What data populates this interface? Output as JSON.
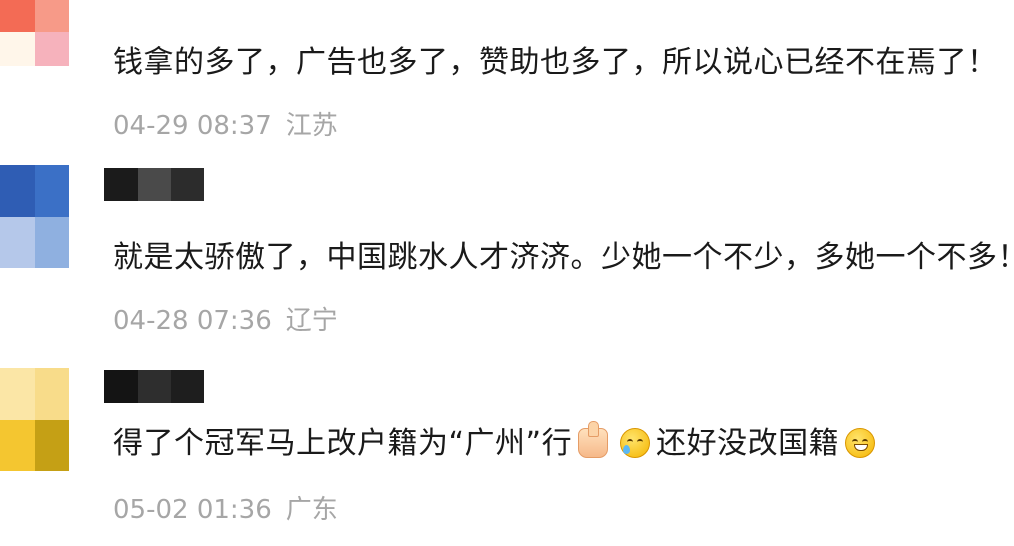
{
  "comments": [
    {
      "avatar_colors": [
        "#f36b55",
        "#f79a88",
        "#fff6ea",
        "#f6b2bc"
      ],
      "name_mask_colors": [],
      "text": "钱拿的多了，广告也多了，赞助也多了，所以说心已经不在焉了！",
      "time": "04-29 08:37",
      "location": "江苏"
    },
    {
      "avatar_colors": [
        "#2f5db4",
        "#3b70c6",
        "#b5c8ea",
        "#8fb0e0"
      ],
      "name_mask_colors": [
        "#1b1b1b",
        "#4a4a4a",
        "#2c2c2c"
      ],
      "text": "就是太骄傲了，中国跳水人才济济。少她一个不少，多她一个不多！",
      "time": "04-28 07:36",
      "location": "辽宁"
    },
    {
      "avatar_colors": [
        "#fbe6a6",
        "#f8dc8a",
        "#f4c630",
        "#c5a015"
      ],
      "name_mask_colors": [
        "#141414",
        "#2e2e2e",
        "#1e1e1e"
      ],
      "text_before": "得了个冠军马上改户籍为“广州”行",
      "emoji_1": "thumbs-up-emoji",
      "emoji_2": "crying-face-emoji",
      "text_after": "还好没改国籍",
      "emoji_3": "grinning-face-emoji",
      "time": "05-02 01:36",
      "location": "广东"
    }
  ]
}
